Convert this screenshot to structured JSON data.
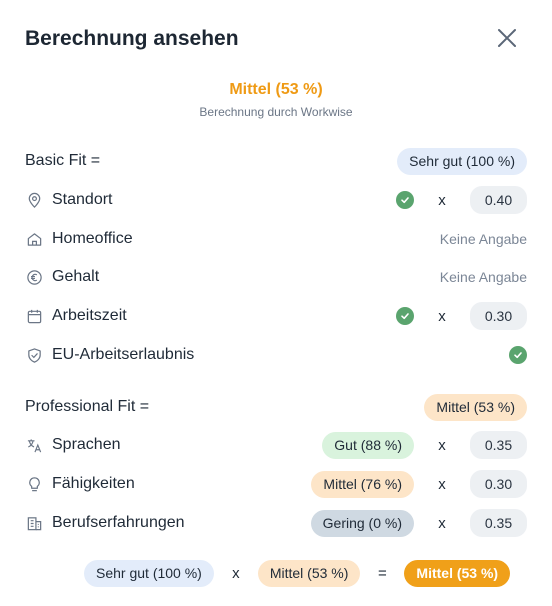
{
  "dialog": {
    "title": "Berechnung ansehen",
    "close_icon": "close-icon"
  },
  "summary": {
    "score": "Mittel (53 %)",
    "subtitle": "Berechnung durch Workwise"
  },
  "basic_fit": {
    "label": "Basic Fit =",
    "score": "Sehr gut (100 %)",
    "items": [
      {
        "label": "Standort",
        "icon": "location-pin-icon",
        "status": "check",
        "times": "x",
        "weight": "0.40"
      },
      {
        "label": "Homeoffice",
        "icon": "home-icon",
        "status": "Keine Angabe"
      },
      {
        "label": "Gehalt",
        "icon": "euro-icon",
        "status": "Keine Angabe"
      },
      {
        "label": "Arbeitszeit",
        "icon": "calendar-icon",
        "status": "check",
        "times": "x",
        "weight": "0.30"
      },
      {
        "label": "EU-Arbeitserlaubnis",
        "icon": "shield-check-icon",
        "status": "check"
      }
    ]
  },
  "professional_fit": {
    "label": "Professional Fit =",
    "score": "Mittel (53 %)",
    "items": [
      {
        "label": "Sprachen",
        "icon": "translate-icon",
        "score": "Gut (88 %)",
        "times": "x",
        "weight": "0.35"
      },
      {
        "label": "Fähigkeiten",
        "icon": "lightbulb-icon",
        "score": "Mittel (76 %)",
        "times": "x",
        "weight": "0.30"
      },
      {
        "label": "Berufserfahrungen",
        "icon": "building-icon",
        "score": "Gering (0 %)",
        "times": "x",
        "weight": "0.35"
      }
    ]
  },
  "footer": {
    "basic": "Sehr gut (100 %)",
    "times": "x",
    "professional": "Mittel (53 %)",
    "equals": "=",
    "result": "Mittel (53 %)"
  },
  "colors": {
    "accent_orange": "#ef9a14",
    "check_green": "#5aa46e",
    "pill_blue": "#e3ecfa",
    "pill_orange": "#fde5c8",
    "pill_green": "#d9f3dd",
    "pill_grey": "#cfd9e2"
  }
}
